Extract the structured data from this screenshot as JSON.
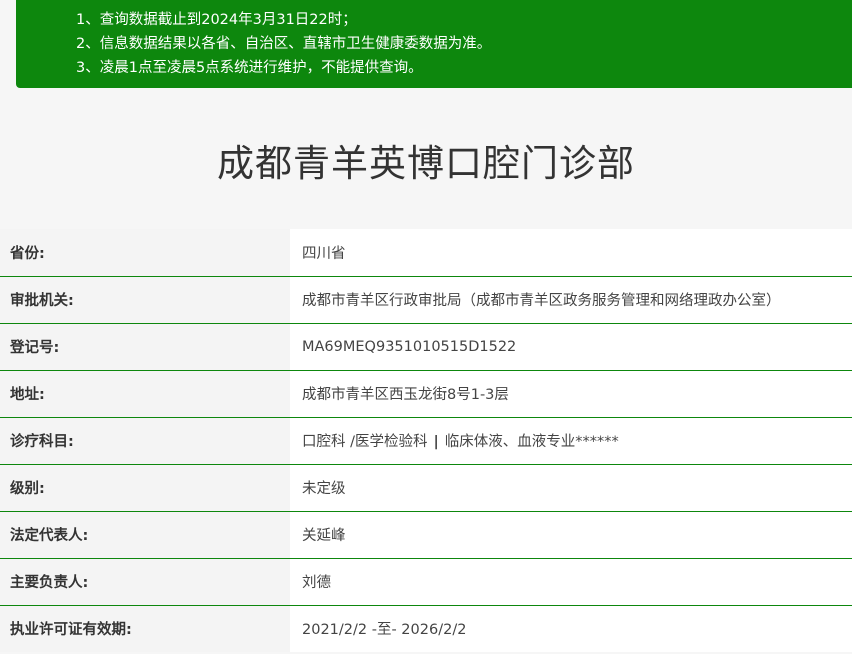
{
  "notice": {
    "lines": [
      "1、查询数据截止到2024年3月31日22时；",
      "2、信息数据结果以各省、自治区、直辖市卫生健康委数据为准。",
      "3、凌晨1点至凌晨5点系统进行维护，不能提供查询。"
    ],
    "background_color": "#0d870d"
  },
  "title": "成都青羊英博口腔门诊部",
  "rows": [
    {
      "label": "省份:",
      "value": "四川省"
    },
    {
      "label": "审批机关:",
      "value": "成都市青羊区行政审批局（成都市青羊区政务服务管理和网络理政办公室）"
    },
    {
      "label": "登记号:",
      "value": "MA69MEQ9351010515D1522"
    },
    {
      "label": "地址:",
      "value": "成都市青羊区西玉龙街8号1-3层"
    },
    {
      "label": "诊疗科目:",
      "value_a": "口腔科 /医学检验科",
      "separator": "|",
      "value_b": "临床体液、血液专业******"
    },
    {
      "label": "级别:",
      "value": "未定级"
    },
    {
      "label": "法定代表人:",
      "value": "关延峰"
    },
    {
      "label": "主要负责人:",
      "value": "刘德"
    },
    {
      "label": "执业许可证有效期:",
      "value": "2021/2/2 -至- 2026/2/2"
    }
  ]
}
